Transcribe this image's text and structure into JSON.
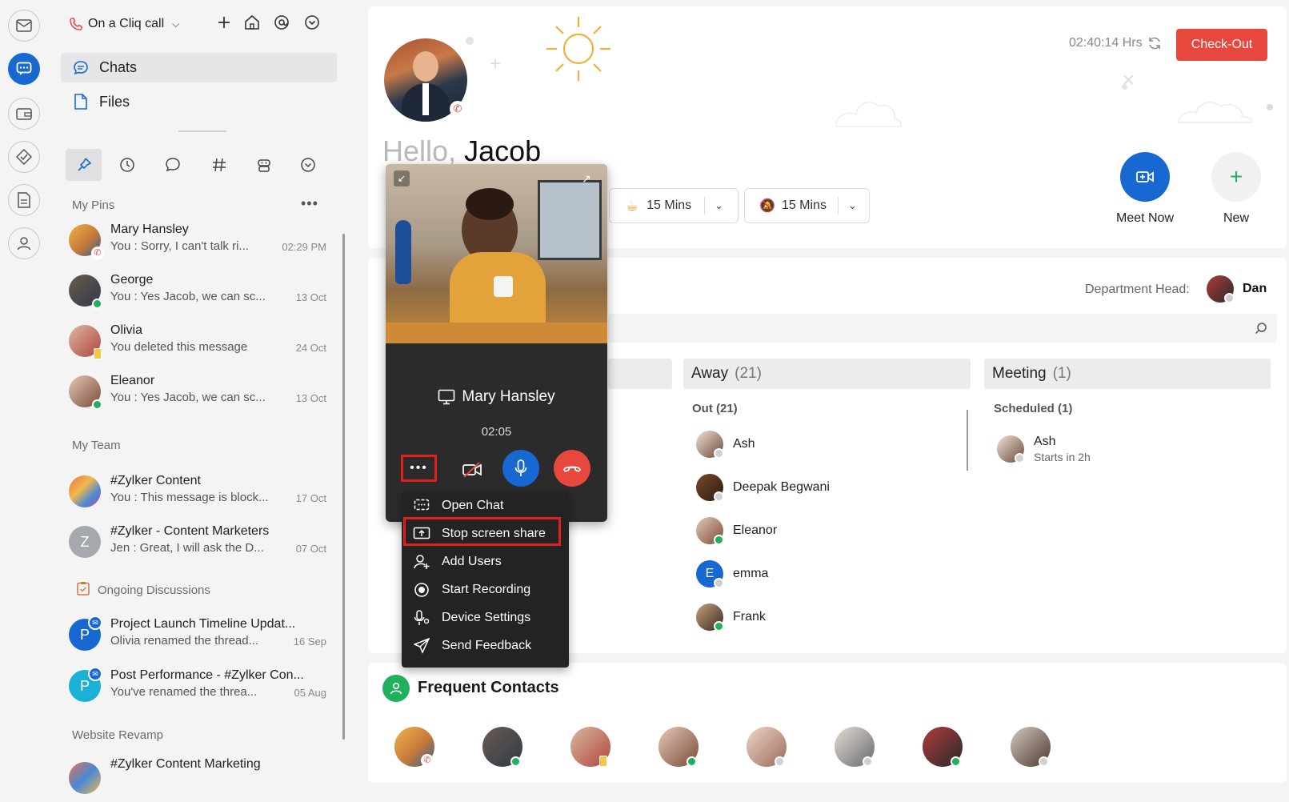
{
  "rail": {
    "icons": [
      "mail-icon",
      "chat-icon",
      "wallet-icon",
      "tasks-icon",
      "document-icon",
      "person-icon"
    ]
  },
  "sidebar": {
    "call_status": "On a Cliq call",
    "nav": [
      {
        "label": "Chats"
      },
      {
        "label": "Files"
      }
    ],
    "sections": {
      "pins": "My Pins",
      "team": "My Team",
      "ongoing": "Ongoing Discussions",
      "website": "Website Revamp"
    },
    "pins": [
      {
        "name": "Mary Hansley",
        "preview": "You : Sorry, I can't talk ri...",
        "time": "02:29 PM"
      },
      {
        "name": "George",
        "preview": "You : Yes Jacob, we can sc...",
        "time": "13 Oct"
      },
      {
        "name": "Olivia",
        "preview": "You deleted this message",
        "time": "24 Oct"
      },
      {
        "name": "Eleanor",
        "preview": "You : Yes Jacob, we can sc...",
        "time": "13 Oct"
      }
    ],
    "team": [
      {
        "name": "#Zylker Content",
        "preview": "You : This message is block...",
        "time": "17 Oct"
      },
      {
        "name": "#Zylker - Content Marketers",
        "preview": "Jen : Great, I will ask the D...",
        "time": "07 Oct",
        "initial": "Z"
      }
    ],
    "ongoing": [
      {
        "name": "Project Launch Timeline Updat...",
        "preview": "Olivia renamed the thread...",
        "time": "16 Sep",
        "initial": "P"
      },
      {
        "name": "Post Performance - #Zylker Con...",
        "preview": "You've renamed the threa...",
        "time": "05 Aug",
        "initial": "P"
      }
    ],
    "website": [
      {
        "name": "#Zylker Content Marketing"
      }
    ]
  },
  "header": {
    "timer": "02:40:14 Hrs",
    "checkout": "Check-Out",
    "greeting": "Hello,",
    "username": "Jacob",
    "break1": "15 Mins",
    "break2": "15 Mins",
    "meet_now": "Meet Now",
    "new": "New"
  },
  "team_panel": {
    "dept_head_label": "Department Head:",
    "dept_head": "Dan",
    "away": {
      "title": "Away",
      "count": "(21)",
      "sub": "Out (21)",
      "people": [
        "Ash",
        "Deepak Begwani",
        "Eleanor",
        "emma",
        "Frank"
      ]
    },
    "meeting": {
      "title": "Meeting",
      "count": "(1)",
      "sub": "Scheduled (1)",
      "people": [
        {
          "name": "Ash",
          "note": "Starts in 2h"
        }
      ]
    }
  },
  "frequent": {
    "title": "Frequent Contacts"
  },
  "call": {
    "name": "Mary Hansley",
    "duration": "02:05",
    "menu": [
      "Open Chat",
      "Stop screen share",
      "Add Users",
      "Start Recording",
      "Device Settings",
      "Send Feedback"
    ]
  },
  "colors": {
    "accent": "#1769d1",
    "checkout": "#e8473d",
    "online": "#1fb15e",
    "end_call": "#e8473d",
    "highlight": "#e0201f"
  }
}
